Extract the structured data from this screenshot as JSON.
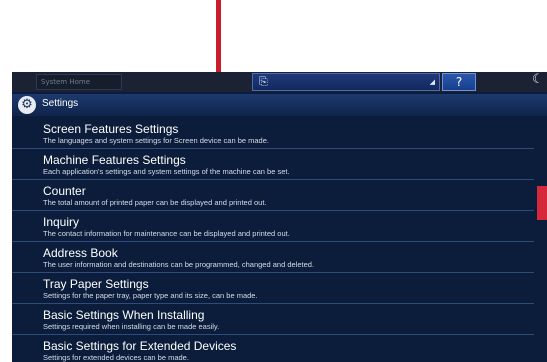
{
  "topbar": {
    "system_home_label": "System Home",
    "help_label": "?"
  },
  "icons": {
    "center": "monitor-icon",
    "moon": "moon-icon",
    "gear": "gear-icon"
  },
  "title": "Settings",
  "items": [
    {
      "title": "Screen Features Settings",
      "desc": "The languages and system settings for Screen device can be made."
    },
    {
      "title": "Machine Features Settings",
      "desc": "Each application's settings and system settings of the machine can be set."
    },
    {
      "title": "Counter",
      "desc": "The total amount of printed paper can be displayed and printed out."
    },
    {
      "title": "Inquiry",
      "desc": "The contact information for maintenance can be displayed and printed out."
    },
    {
      "title": "Address Book",
      "desc": "The user information and destinations can be programmed, changed and deleted."
    },
    {
      "title": "Tray Paper Settings",
      "desc": "Settings for the paper tray, paper type and its size, can be made."
    },
    {
      "title": "Basic Settings When Installing",
      "desc": "Settings required when installing can be made easily."
    },
    {
      "title": "Basic Settings for Extended Devices",
      "desc": "Settings for extended devices can be made."
    }
  ],
  "colors": {
    "arrow": "#c81e2c",
    "panel_bg": "#0b1d3a",
    "scroll_marker": "#d6283b"
  }
}
